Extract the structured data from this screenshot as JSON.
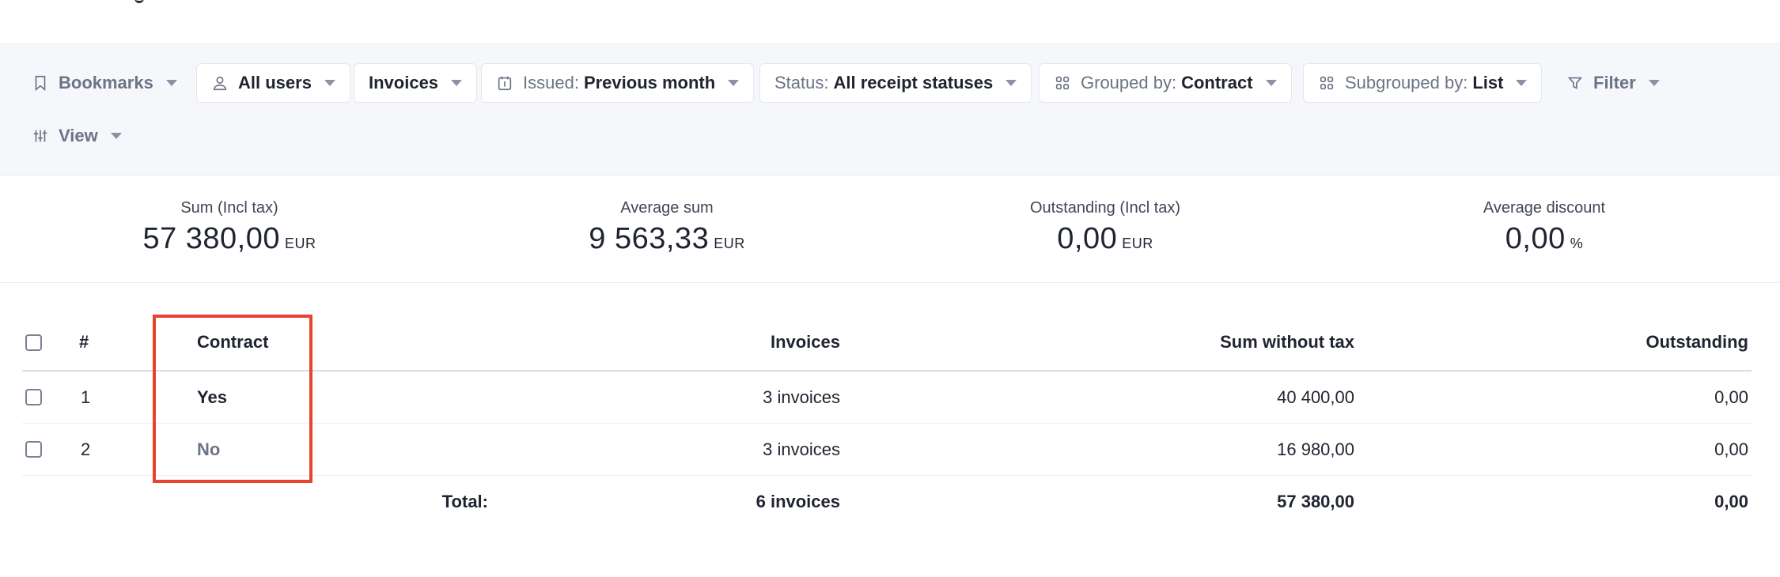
{
  "toolbar": {
    "bookmarks": "Bookmarks",
    "users": "All users",
    "doc_type": "Invoices",
    "issued_label": "Issued:",
    "issued_value": "Previous month",
    "status_label": "Status:",
    "status_value": "All receipt statuses",
    "grouped_label": "Grouped by:",
    "grouped_value": "Contract",
    "subgrouped_label": "Subgrouped by:",
    "subgrouped_value": "List",
    "filter": "Filter",
    "view": "View"
  },
  "stats": [
    {
      "label": "Sum (Incl tax)",
      "value": "57 380,00",
      "unit": "EUR"
    },
    {
      "label": "Average sum",
      "value": "9 563,33",
      "unit": "EUR"
    },
    {
      "label": "Outstanding (Incl tax)",
      "value": "0,00",
      "unit": "EUR"
    },
    {
      "label": "Average discount",
      "value": "0,00",
      "unit": "%"
    }
  ],
  "table": {
    "headers": {
      "index": "#",
      "contract": "Contract",
      "invoices": "Invoices",
      "sum": "Sum without tax",
      "outstanding": "Outstanding"
    },
    "rows": [
      {
        "index": "1",
        "contract": "Yes",
        "invoices": "3 invoices",
        "sum": "40 400,00",
        "outstanding": "0,00"
      },
      {
        "index": "2",
        "contract": "No",
        "invoices": "3 invoices",
        "sum": "16 980,00",
        "outstanding": "0,00"
      }
    ],
    "total": {
      "label": "Total:",
      "invoices": "6 invoices",
      "sum": "57 380,00",
      "outstanding": "0,00"
    }
  },
  "colors": {
    "highlight": "#e8432d",
    "toolbar_bg": "#f5f7fb",
    "muted_text": "#6b7385"
  },
  "icons": [
    "bookmark-icon",
    "user-icon",
    "calendar-icon",
    "grid-icon",
    "filter-icon",
    "sliders-icon",
    "caret-down-icon",
    "checkbox-icon"
  ]
}
